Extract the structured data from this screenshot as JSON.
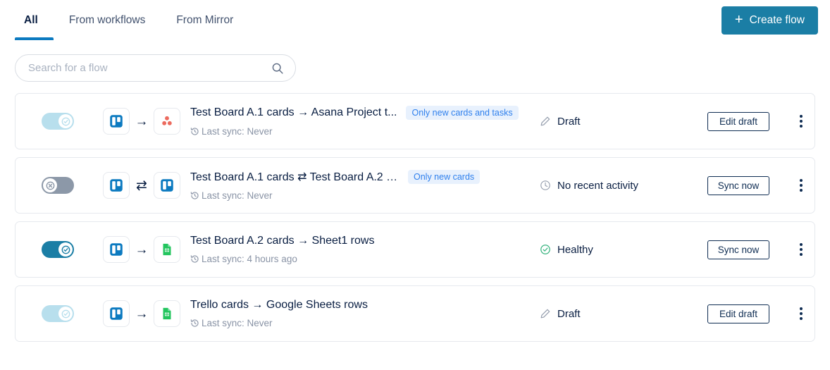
{
  "theme": {
    "accent_blue": "#0c7ac0",
    "button_teal": "#1b7ea5",
    "badge_text": "#2f80ed",
    "badge_bg": "#e8f1fd",
    "healthy_green": "#36b37e",
    "muted_text": "#8a94a6"
  },
  "tabs": [
    {
      "label": "All",
      "active": true
    },
    {
      "label": "From workflows",
      "active": false
    },
    {
      "label": "From Mirror",
      "active": false
    }
  ],
  "header": {
    "create_flow_label": "Create flow",
    "create_flow_icon": "plus-icon"
  },
  "search": {
    "placeholder": "Search for a flow",
    "value": "",
    "icon": "search-icon"
  },
  "flows": [
    {
      "toggle_state": "draft",
      "toggle_icon": "check-icon",
      "source_app": "trello",
      "target_app": "asana",
      "direction_icon": "arrow-right-icon",
      "title": "Test Board A.1 cards → Asana Project t...",
      "badge": "Only new cards and tasks",
      "sync_icon": "history-icon",
      "sync_text": "Last sync: Never",
      "status_icon": "pencil-icon",
      "status_text": "Draft",
      "action_label": "Edit draft",
      "menu_icon": "kebab-menu-icon"
    },
    {
      "toggle_state": "off",
      "toggle_icon": "close-icon",
      "source_app": "trello",
      "target_app": "trello",
      "direction_icon": "arrows-two-way-icon",
      "title": "Test Board A.1 cards ⇄ Test Board A.2 c...",
      "badge": "Only new cards",
      "sync_icon": "history-icon",
      "sync_text": "Last sync: Never",
      "status_icon": "clock-icon",
      "status_text": "No recent activity",
      "action_label": "Sync now",
      "menu_icon": "kebab-menu-icon"
    },
    {
      "toggle_state": "on",
      "toggle_icon": "check-icon",
      "source_app": "trello",
      "target_app": "google-sheets",
      "direction_icon": "arrow-right-icon",
      "title": "Test Board A.2 cards → Sheet1 rows",
      "badge": "",
      "sync_icon": "history-icon",
      "sync_text": "Last sync: 4 hours ago",
      "status_icon": "check-circle-icon",
      "status_text": "Healthy",
      "action_label": "Sync now",
      "menu_icon": "kebab-menu-icon"
    },
    {
      "toggle_state": "draft",
      "toggle_icon": "check-icon",
      "source_app": "trello",
      "target_app": "google-sheets",
      "direction_icon": "arrow-right-icon",
      "title": "Trello cards → Google Sheets rows",
      "badge": "",
      "sync_icon": "history-icon",
      "sync_text": "Last sync: Never",
      "status_icon": "pencil-icon",
      "status_text": "Draft",
      "action_label": "Edit draft",
      "menu_icon": "kebab-menu-icon"
    }
  ]
}
